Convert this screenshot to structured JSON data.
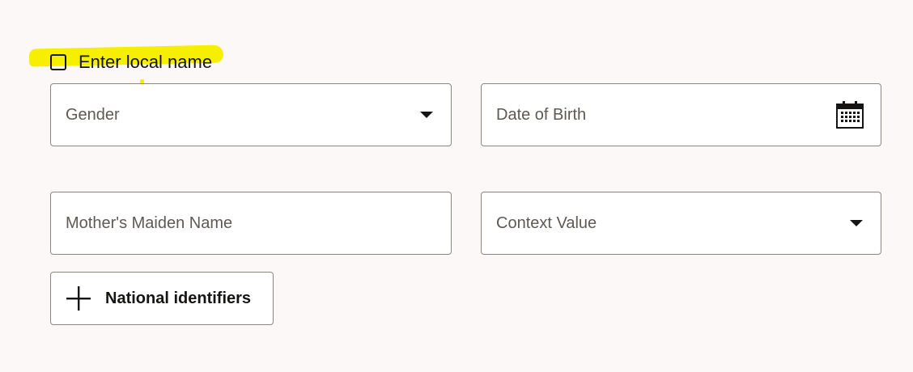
{
  "local_name_checkbox": {
    "label": "Enter local name",
    "checked": false
  },
  "fields": {
    "gender": {
      "label": "Gender",
      "icon": "chevron-down-icon"
    },
    "date_of_birth": {
      "label": "Date of Birth",
      "icon": "calendar-icon"
    },
    "mothers_maiden_name": {
      "label": "Mother's Maiden Name"
    },
    "context_value": {
      "label": "Context Value",
      "icon": "chevron-down-icon"
    }
  },
  "add_national_identifiers": {
    "label": "National identifiers",
    "icon": "plus-icon"
  },
  "colors": {
    "background": "#fcf8f7",
    "highlight": "#f7ef00",
    "field_border": "#8b8680",
    "placeholder_text": "#5e5954",
    "text": "#161513"
  }
}
